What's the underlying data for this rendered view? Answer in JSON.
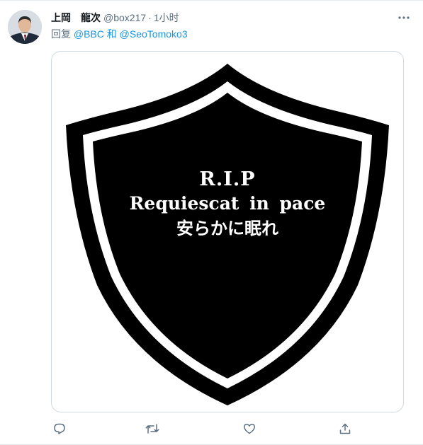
{
  "tweet": {
    "display_name": "上岡　龍次",
    "handle": "@box217",
    "separator": "·",
    "time": "1小时",
    "reply_prefix": "回复",
    "mentions": [
      "@BBC 和",
      "@SeoTomoko3"
    ]
  },
  "image": {
    "line1": "R.I.P",
    "line2": "Requiescat in pace",
    "line3": "安らかに眠れ"
  },
  "icons": {
    "more": "more-horizontal-icon",
    "reply": "reply-icon",
    "retweet": "retweet-icon",
    "like": "heart-icon",
    "share": "share-icon"
  },
  "colors": {
    "text_primary": "#0f1419",
    "text_secondary": "#5b7083",
    "link": "#1b95e0",
    "shield": "#000000"
  }
}
